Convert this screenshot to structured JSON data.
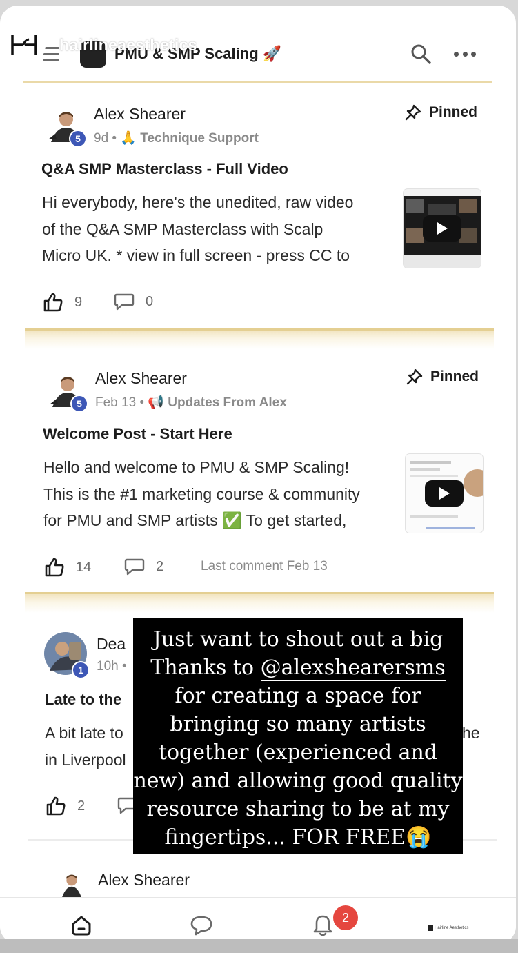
{
  "story_account": "hairlineaesthetics",
  "header": {
    "group_title": "PMU & SMP Scaling 🚀"
  },
  "posts": [
    {
      "author": "Alex Shearer",
      "level": "5",
      "age": "9d",
      "category": "🙏 Technique Support",
      "pinned_label": "Pinned",
      "title": "Q&A SMP Masterclass - Full Video",
      "body_lines": [
        "Hi everybody, here's the unedited, raw video",
        "of the Q&A SMP Masterclass with Scalp",
        "Micro UK. * view in full screen - press CC to"
      ],
      "likes": "9",
      "comments": "0"
    },
    {
      "author": "Alex Shearer",
      "level": "5",
      "age": "Feb 13",
      "category": "📢 Updates From Alex",
      "pinned_label": "Pinned",
      "title": "Welcome Post - Start Here",
      "body_lines": [
        "Hello and welcome to PMU & SMP Scaling!",
        "This is the #1 marketing course & community",
        "for PMU and SMP artists ✅ To get started,"
      ],
      "likes": "14",
      "comments": "2",
      "last_comment": "Last comment Feb 13"
    },
    {
      "author_partial": "Dea",
      "level": "1",
      "age_partial": "10h •",
      "title_partial": "Late to the",
      "body_partial_1": "A bit late to",
      "body_partial_1_right": "he",
      "body_partial_2": "in Liverpool",
      "likes": "2"
    },
    {
      "author": "Alex Shearer"
    }
  ],
  "story_text": {
    "line1": "Just want to shout out a big",
    "line2_prefix": "Thanks to ",
    "mention": "@alexshearersms",
    "line3": "for creating a space for",
    "line4": "bringing so many artists",
    "line5": "together (experienced and",
    "line6": "new) and allowing good quality",
    "line7": "resource sharing to be at my",
    "line8": "fingertips... FOR FREE😭"
  },
  "bottom_nav": {
    "notification_count": "2",
    "brand_text": "Hairline Aesthetics"
  },
  "icons": [
    "hamburger-icon",
    "search-icon",
    "more-icon",
    "pin-icon",
    "thumbs-up-icon",
    "comment-icon",
    "play-icon",
    "home-icon",
    "chat-icon",
    "bell-icon"
  ],
  "colors": {
    "level_badge": "#3d57b6",
    "notification": "#e5473f",
    "gold_divider": "#ead9a8"
  }
}
